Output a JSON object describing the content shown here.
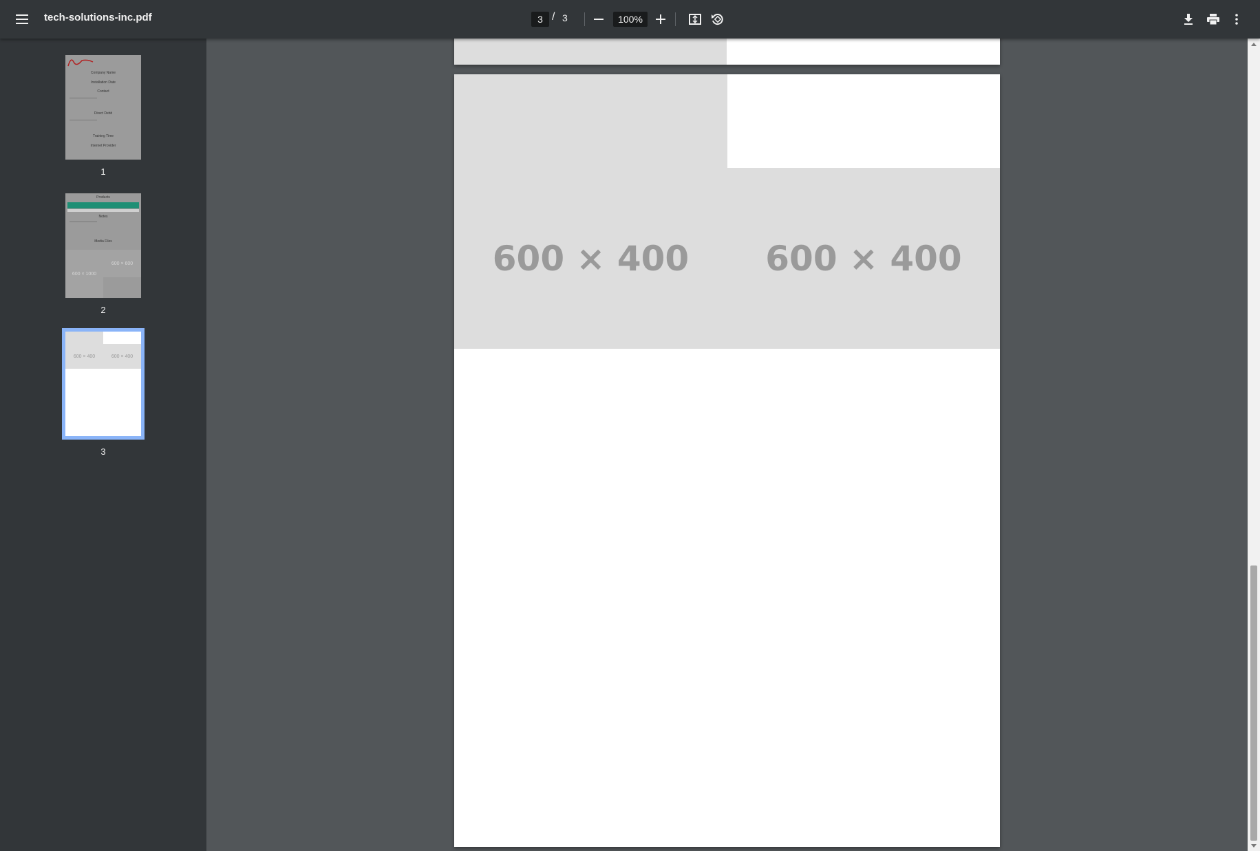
{
  "toolbar": {
    "title": "tech-solutions-inc.pdf",
    "current_page": "3",
    "page_separator": "/",
    "total_pages": "3",
    "zoom": "100%",
    "icons": [
      "menu-icon",
      "zoom-out-icon",
      "zoom-in-icon",
      "fit-page-icon",
      "rotate-icon",
      "download-icon",
      "print-icon",
      "more-vert-icon"
    ]
  },
  "sidebar": {
    "thumbnails": [
      {
        "number": "1",
        "lines": [
          "Company Name",
          "Installation Date",
          "Contact",
          "Direct Debit",
          "Training Time",
          "Internet Provider"
        ]
      },
      {
        "number": "2",
        "lines": [
          "Products",
          "Notes",
          "Media Files"
        ],
        "images": [
          "600 × 600",
          "600 × 1000"
        ]
      },
      {
        "number": "3",
        "images": [
          "600 × 400",
          "600 × 400"
        ],
        "selected": true
      }
    ],
    "selected_color": "#8ab4f8"
  },
  "viewer": {
    "page_number": 3,
    "placeholders": [
      "600 × 400",
      "600 × 400"
    ],
    "placeholder_color": "#dddddd",
    "background": "#525659"
  }
}
